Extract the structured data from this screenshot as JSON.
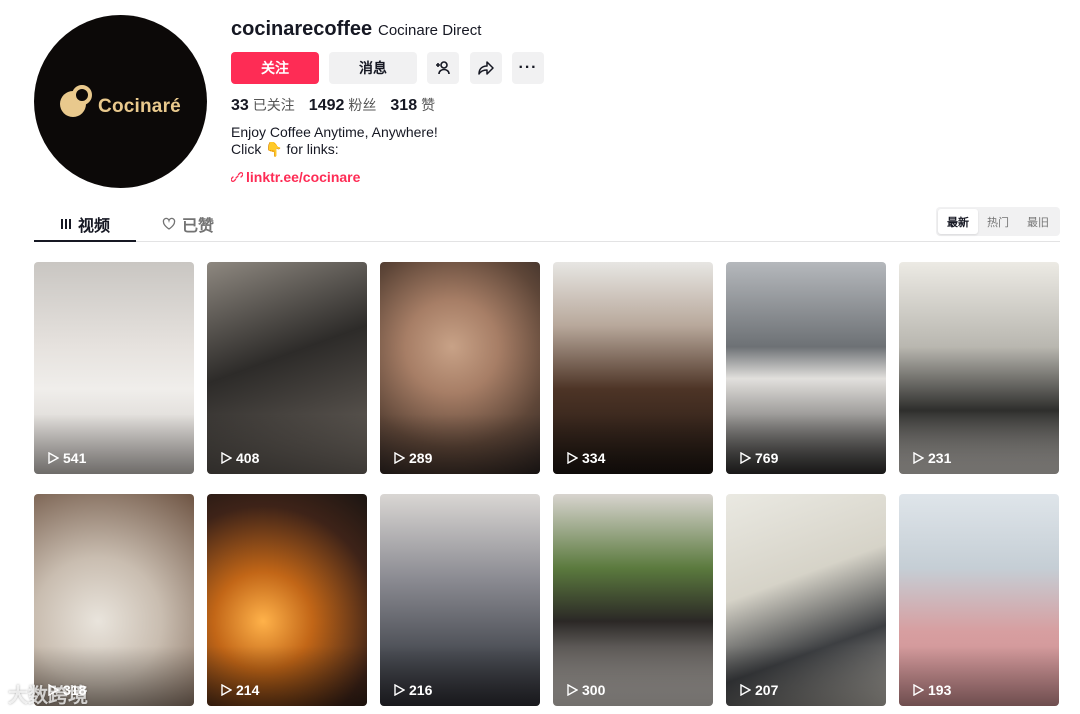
{
  "profile": {
    "username": "cocinarecoffee",
    "nickname": "Cocinare Direct",
    "avatar_logo_text": "Cocinaré"
  },
  "actions": {
    "follow_label": "关注",
    "message_label": "消息",
    "add_friend_icon": "add-person-icon",
    "share_icon": "share-icon",
    "more_label": "···"
  },
  "stats": {
    "following_count": "33",
    "following_label": "已关注",
    "followers_count": "1492",
    "followers_label": "粉丝",
    "likes_count": "318",
    "likes_label": "赞"
  },
  "bio": {
    "line1": "Enjoy Coffee Anytime, Anywhere!",
    "line2": "Click 👇 for links:",
    "link": "linktr.ee/cocinare"
  },
  "tabs": {
    "videos": "视频",
    "liked": "已赞"
  },
  "sort": {
    "options": [
      "最新",
      "热门",
      "最旧"
    ],
    "selected": "最新"
  },
  "videos": [
    {
      "views": "541"
    },
    {
      "views": "408"
    },
    {
      "views": "289"
    },
    {
      "views": "334"
    },
    {
      "views": "769"
    },
    {
      "views": "231"
    },
    {
      "views": "318"
    },
    {
      "views": "214"
    },
    {
      "views": "216"
    },
    {
      "views": "300"
    },
    {
      "views": "207"
    },
    {
      "views": "193"
    }
  ],
  "watermark": "大数跨境",
  "colors": {
    "accent": "#fe2c55",
    "text": "#161823",
    "button_bg": "#f1f1f2"
  }
}
